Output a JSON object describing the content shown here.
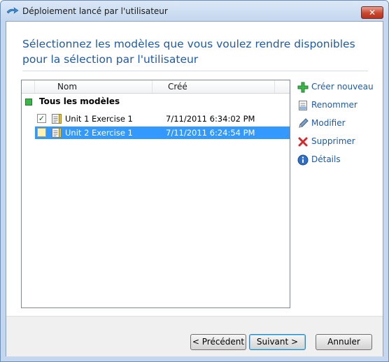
{
  "window": {
    "title": "Déploiement lancé par l'utilisateur",
    "close_glyph": "✕",
    "app_icon": "wizard-arrow-icon"
  },
  "heading": "Sélectionnez les modèles que vous voulez rendre disponibles pour la sélection par l'utilisateur",
  "list": {
    "columns": [
      "Nom",
      "Créé"
    ],
    "group_label": "Tous les modèles",
    "rows": [
      {
        "name": "Unit 1 Exercise 1",
        "created": "7/11/2011 6:34:02 PM",
        "checked": true,
        "selected": false,
        "check_glyph": "✓"
      },
      {
        "name": "Unit 2 Exercise 1",
        "created": "7/11/2011 6:24:54 PM",
        "checked": false,
        "selected": true,
        "check_glyph": ""
      }
    ]
  },
  "actions": [
    {
      "label": "Créer nouveau",
      "icon": "green-plus-icon"
    },
    {
      "label": "Renommer",
      "icon": "rename-icon"
    },
    {
      "label": "Modifier",
      "icon": "pencil-icon"
    },
    {
      "label": "Supprimer",
      "icon": "red-x-icon"
    },
    {
      "label": "Détails",
      "icon": "info-icon"
    }
  ],
  "buttons": {
    "previous": "< Précédent",
    "next": "Suivant >",
    "cancel": "Annuler"
  },
  "colors": {
    "heading": "#1e5aa8",
    "selection": "#3399ff",
    "link": "#1e5aa8",
    "add": "#3cb64a",
    "delete": "#d22a2a"
  }
}
